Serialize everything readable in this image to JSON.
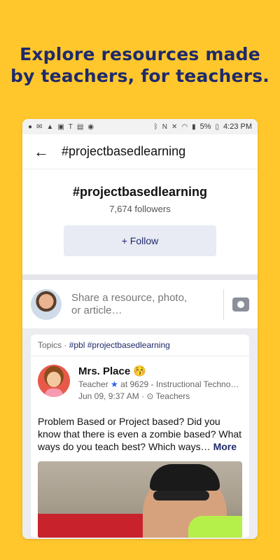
{
  "promo": {
    "line1": "Explore resources made",
    "line2": "by teachers, for teachers."
  },
  "status_bar": {
    "battery": "5%",
    "time": "4:23 PM"
  },
  "app_bar": {
    "title": "#projectbasedlearning"
  },
  "hashtag_header": {
    "name": "#projectbasedlearning",
    "followers": "7,674 followers",
    "follow_label": "+ Follow"
  },
  "share": {
    "placeholder_line1": "Share a resource, photo,",
    "placeholder_line2": "or article…"
  },
  "post": {
    "topics_label": "Topics",
    "topics": [
      "#pbl",
      "#projectbasedlearning"
    ],
    "author_name": "Mrs. Place 😚",
    "author_role": "Teacher",
    "author_school": "at 9629 - Instructional Techno…",
    "date": "Jun 09, 9:37 AM",
    "audience": "Teachers",
    "body": "Problem Based or Project based? Did you know that there is even a zombie based? What ways do you teach best? Which ways…",
    "more_label": "More"
  },
  "colors": {
    "background": "#FFC72C",
    "accent": "#1f2a6b"
  }
}
